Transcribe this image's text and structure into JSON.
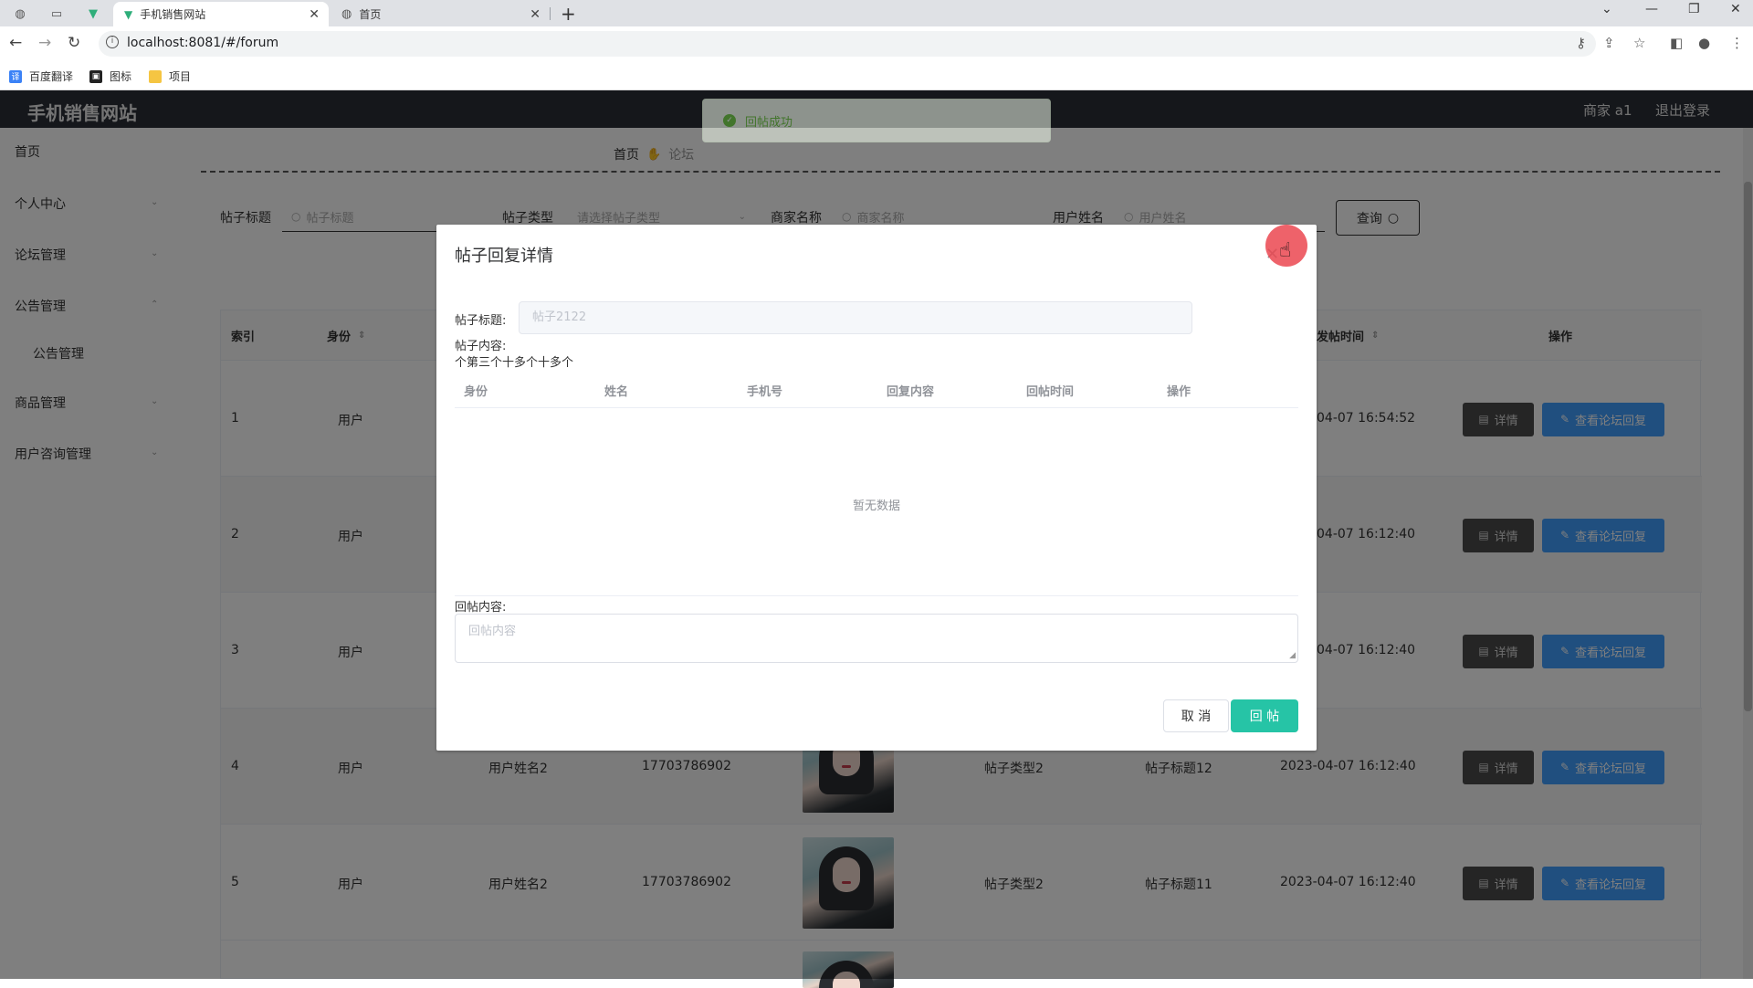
{
  "browser": {
    "tabs": [
      {
        "title": "手机销售网站",
        "active": true
      },
      {
        "title": "首页",
        "active": false
      }
    ],
    "url": "localhost:8081/#/forum",
    "bookmarks": [
      "百度翻译",
      "图标",
      "项目"
    ]
  },
  "app": {
    "brand": "手机销售网站",
    "user": "商家 a1",
    "logout": "退出登录",
    "sidebar": [
      "首页",
      "个人中心",
      "论坛管理",
      "公告管理",
      "公告管理",
      "商品管理",
      "用户咨询管理"
    ],
    "breadcrumb": {
      "home": "首页",
      "current": "论坛"
    },
    "filters": [
      {
        "label": "帖子标题",
        "placeholder": "帖子标题"
      },
      {
        "label": "帖子类型",
        "placeholder": "请选择帖子类型"
      },
      {
        "label": "商家名称",
        "placeholder": "商家名称"
      },
      {
        "label": "用户姓名",
        "placeholder": "用户姓名"
      }
    ],
    "query_button": "查询",
    "table": {
      "headers": [
        "索引",
        "身份",
        "发帖时间",
        "操作"
      ],
      "rows": [
        {
          "index": "1",
          "identity": "用户",
          "name": "",
          "phone": "",
          "type": "",
          "title": "",
          "time": "04-07 16:54:52"
        },
        {
          "index": "2",
          "identity": "用户",
          "name": "",
          "phone": "",
          "type": "",
          "title": "",
          "time": "04-07 16:12:40"
        },
        {
          "index": "3",
          "identity": "用户",
          "name": "",
          "phone": "",
          "type": "",
          "title": "",
          "time": "04-07 16:12:40"
        },
        {
          "index": "4",
          "identity": "用户",
          "name": "用户姓名2",
          "phone": "17703786902",
          "type": "帖子类型2",
          "title": "帖子标题12",
          "time": "2023-04-07 16:12:40"
        },
        {
          "index": "5",
          "identity": "用户",
          "name": "用户姓名2",
          "phone": "17703786902",
          "type": "帖子类型2",
          "title": "帖子标题11",
          "time": "2023-04-07 16:12:40"
        }
      ],
      "detail_label": "详情",
      "reply_label": "查看论坛回复"
    }
  },
  "toast": {
    "message": "回帖成功"
  },
  "dialog": {
    "title": "帖子回复详情",
    "post_title_label": "帖子标题:",
    "post_title_value": "帖子2122",
    "post_content_label": "帖子内容:",
    "post_content_value": "个第三个十多个十多个",
    "columns": [
      "身份",
      "姓名",
      "手机号",
      "回复内容",
      "回帖时间",
      "操作"
    ],
    "empty_text": "暂无数据",
    "reply_label": "回帖内容:",
    "reply_placeholder": "回帖内容",
    "cancel": "取 消",
    "submit": "回 帖"
  },
  "colors": {
    "accent": "#26c4a6",
    "primary": "#409eff",
    "success": "#67c23a"
  }
}
